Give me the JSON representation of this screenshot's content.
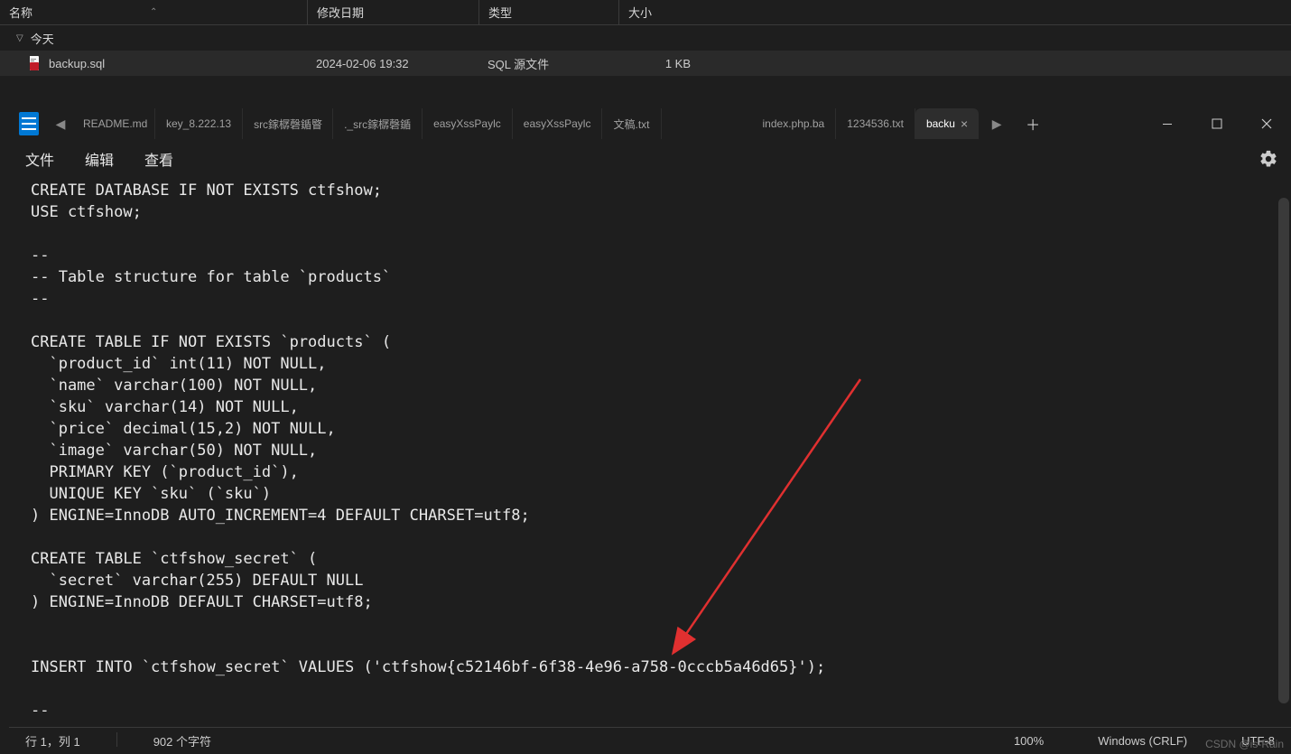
{
  "explorer": {
    "columns": {
      "name": "名称",
      "date": "修改日期",
      "type": "类型",
      "size": "大小"
    },
    "group": "今天",
    "file": {
      "name": "backup.sql",
      "date": "2024-02-06 19:32",
      "type": "SQL 源文件",
      "size": "1 KB"
    }
  },
  "tabs": [
    {
      "label": "README.md",
      "active": false
    },
    {
      "label": "key_8.222.13",
      "active": false
    },
    {
      "label": "src鎵樼磬鍎睯",
      "active": false
    },
    {
      "label": "._src鎵樼磬鍎",
      "active": false
    },
    {
      "label": "easyXssPaylc",
      "active": false
    },
    {
      "label": "easyXssPaylc",
      "active": false
    },
    {
      "label": "文稿.txt",
      "active": false
    },
    {
      "label": "index.php.ba",
      "active": false
    },
    {
      "label": "1234536.txt",
      "active": false
    },
    {
      "label": "backu",
      "active": true
    }
  ],
  "menu": {
    "file": "文件",
    "edit": "编辑",
    "view": "查看"
  },
  "content_lines": [
    "CREATE DATABASE IF NOT EXISTS ctfshow;",
    "USE ctfshow;",
    "",
    "--",
    "-- Table structure for table `products`",
    "--",
    "",
    "CREATE TABLE IF NOT EXISTS `products` (",
    "  `product_id` int(11) NOT NULL,",
    "  `name` varchar(100) NOT NULL,",
    "  `sku` varchar(14) NOT NULL,",
    "  `price` decimal(15,2) NOT NULL,",
    "  `image` varchar(50) NOT NULL,",
    "  PRIMARY KEY (`product_id`),",
    "  UNIQUE KEY `sku` (`sku`)",
    ") ENGINE=InnoDB AUTO_INCREMENT=4 DEFAULT CHARSET=utf8;",
    "",
    "CREATE TABLE `ctfshow_secret` (",
    "  `secret` varchar(255) DEFAULT NULL",
    ") ENGINE=InnoDB DEFAULT CHARSET=utf8;",
    "",
    "",
    "INSERT INTO `ctfshow_secret` VALUES ('ctfshow{c52146bf-6f38-4e96-a758-0cccb5a46d65}');",
    "",
    "--"
  ],
  "status": {
    "position": "行 1，列 1",
    "chars": "902 个字符",
    "zoom": "100%",
    "line_ending": "Windows (CRLF)",
    "encoding": "UTF-8"
  },
  "watermark": "CSDN @is-Rain"
}
